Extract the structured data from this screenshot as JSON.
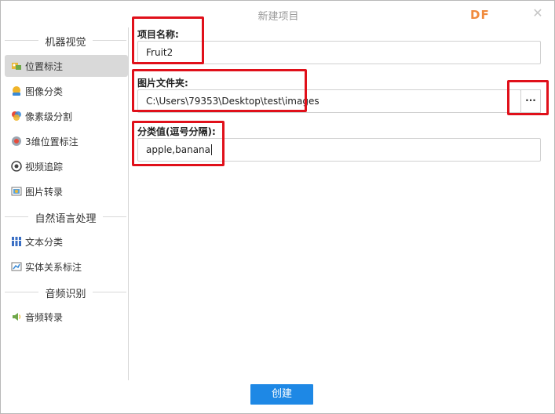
{
  "window": {
    "title": "新建项目",
    "logo": "DF",
    "close": "✕"
  },
  "sidebar": {
    "groups": [
      {
        "label": "机器视觉"
      },
      {
        "label": "自然语言处理"
      },
      {
        "label": "音频识别"
      }
    ],
    "items": [
      {
        "label": "位置标注",
        "icon": "position-tag-icon",
        "active": true
      },
      {
        "label": "图像分类",
        "icon": "image-classify-icon"
      },
      {
        "label": "像素级分割",
        "icon": "pixel-segment-icon"
      },
      {
        "label": "3维位置标注",
        "icon": "3d-position-icon"
      },
      {
        "label": "视频追踪",
        "icon": "video-track-icon"
      },
      {
        "label": "图片转录",
        "icon": "image-transcribe-icon"
      },
      {
        "label": "文本分类",
        "icon": "text-classify-icon"
      },
      {
        "label": "实体关系标注",
        "icon": "entity-relation-icon"
      },
      {
        "label": "音频转录",
        "icon": "audio-transcribe-icon"
      }
    ]
  },
  "form": {
    "name_label": "项目名称:",
    "name_value": "Fruit2",
    "folder_label": "图片文件夹:",
    "folder_value": "C:\\Users\\79353\\Desktop\\test\\images",
    "browse_label": "···",
    "classes_label": "分类值(逗号分隔):",
    "classes_value": "apple,banana"
  },
  "actions": {
    "create_label": "创建"
  },
  "colors": {
    "accent": "#1e88e5",
    "highlight": "#e0101a",
    "logo": "#f08a3c"
  }
}
